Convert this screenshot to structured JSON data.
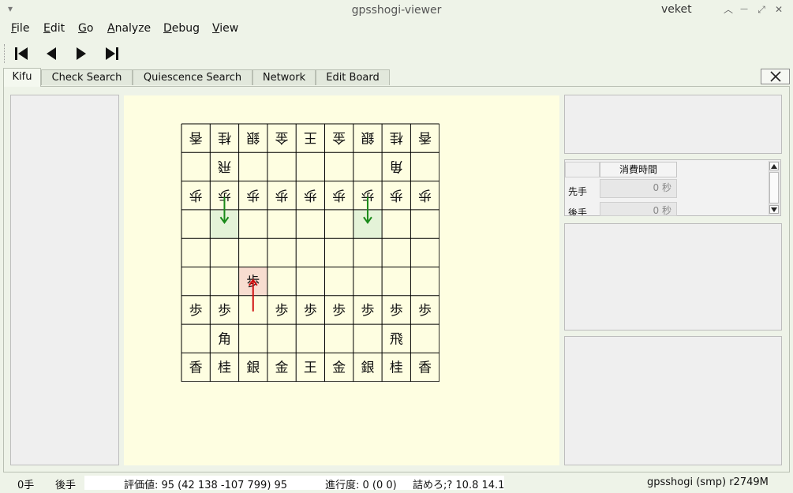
{
  "window": {
    "title": "gpsshogi-viewer",
    "user": "veket",
    "menu_glyph": "▾",
    "btn_up": "︿",
    "btn_min": "—",
    "btn_max": "⤢",
    "btn_close": "✕"
  },
  "menu": [
    "File",
    "Edit",
    "Go",
    "Analyze",
    "Debug",
    "View"
  ],
  "toolbar": {
    "icons": [
      "first-move-icon",
      "prev-move-icon",
      "next-move-icon",
      "last-move-icon"
    ]
  },
  "tabs": [
    "Kifu",
    "Check Search",
    "Quiescence Search",
    "Network",
    "Edit Board"
  ],
  "board": {
    "rows": [
      [
        "香",
        "桂",
        "銀",
        "金",
        "王",
        "金",
        "銀",
        "桂",
        "香"
      ],
      [
        "",
        "飛",
        "",
        "",
        "",
        "",
        "",
        "角",
        ""
      ],
      [
        "歩",
        "歩",
        "歩",
        "歩",
        "歩",
        "歩",
        "歩",
        "歩",
        "歩"
      ],
      [
        "",
        "",
        "",
        "",
        "",
        "",
        "",
        "",
        ""
      ],
      [
        "",
        "",
        "",
        "",
        "",
        "",
        "",
        "",
        ""
      ],
      [
        "",
        "",
        "歩",
        "",
        "",
        "",
        "",
        "",
        ""
      ],
      [
        "歩",
        "歩",
        "",
        "歩",
        "歩",
        "歩",
        "歩",
        "歩",
        "歩"
      ],
      [
        "",
        "角",
        "",
        "",
        "",
        "",
        "",
        "飛",
        ""
      ],
      [
        "香",
        "桂",
        "銀",
        "金",
        "王",
        "金",
        "銀",
        "桂",
        "香"
      ]
    ],
    "flipped_rows": [
      0,
      1,
      2
    ],
    "highlights": [
      {
        "row": 3,
        "col": 1,
        "color": "#e4f3d8"
      },
      {
        "row": 3,
        "col": 6,
        "color": "#e4f3d8"
      },
      {
        "row": 5,
        "col": 2,
        "color": "#f8ddd0"
      }
    ],
    "arrows": [
      {
        "col": 1,
        "from_row": 2,
        "to_row": 3,
        "color": "#1a8a1a"
      },
      {
        "col": 6,
        "from_row": 2,
        "to_row": 3,
        "color": "#1a8a1a"
      },
      {
        "col": 2,
        "from_row": 6,
        "to_row": 5,
        "color": "#d01010"
      }
    ]
  },
  "time_table": {
    "header": "消費時間",
    "rows": [
      {
        "label": "先手",
        "value": "0 秒"
      },
      {
        "label": "後手",
        "value": "0 秒"
      }
    ]
  },
  "status": {
    "moves": "0手",
    "turn": "後手",
    "eval": "評価値: 95 (42 138 -107 799) 95",
    "progress": "進行度: 0 (0 0)",
    "mate": "詰めろ;? 10.8 14.1",
    "engine": "gpsshogi (smp) r2749M"
  }
}
